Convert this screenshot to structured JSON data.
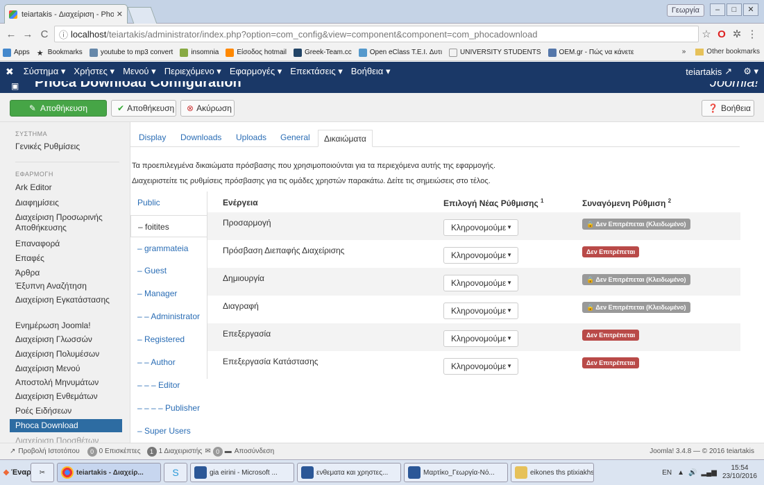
{
  "browser": {
    "tab_title": "teiartakis - Διαχείριση - Pho",
    "user_chip": "Γεωργία",
    "url_host": "localhost",
    "url_path": "/teiartakis/administrator/index.php?option=com_config&view=component&component=com_phocadownload",
    "bookmarks": [
      "Apps",
      "Bookmarks",
      "youtube to mp3 convert",
      "insomnia",
      "Είσοδος hotmail",
      "Greek-Team.cc",
      "Open eClass T.E.I. Δυτι",
      "UNIVERSITY STUDENTS",
      "OEM.gr - Πώς να κάνετε"
    ],
    "other_bookmarks": "Other bookmarks"
  },
  "nav": {
    "menus": [
      "Σύστημα ▾",
      "Χρήστες ▾",
      "Μενού ▾",
      "Περιεχόμενο ▾",
      "Εφαρμογές ▾",
      "Επεκτάσεις ▾",
      "Βοήθεια ▾"
    ],
    "user": "teiartakis"
  },
  "page_title": "Phoca Download Configuration",
  "brand": "Joomla!",
  "toolbar": {
    "save_close": "Αποθήκευση",
    "save": "Αποθήκευση",
    "cancel": "Ακύρωση",
    "help": "Βοήθεια"
  },
  "sidebar": {
    "system_header": "ΣΥΣΤΗΜΑ",
    "system_items": [
      "Γενικές Ρυθμίσεις"
    ],
    "app_header": "ΕΦΑΡΜΟΓΗ",
    "app_items": [
      "Ark Editor",
      "Διαφημίσεις",
      "Διαχείριση Προσωρινής Αποθήκευσης",
      "Επαναφορά",
      "Επαφές",
      "Άρθρα",
      "Έξυπνη Αναζήτηση",
      "Διαχείριση Εγκατάστασης",
      "Ενημέρωση Joomla!",
      "Διαχείριση Γλωσσών",
      "Διαχείριση Πολυμέσων",
      "Διαχείριση Μενού",
      "Αποστολή Μηνυμάτων",
      "Διαχείριση Ενθεμάτων",
      "Ροές Ειδήσεων",
      "Phoca Download",
      "Διαχείριση Προσθέτων"
    ]
  },
  "tabs": [
    "Display",
    "Downloads",
    "Uploads",
    "General",
    "Δικαιώματα"
  ],
  "intro": {
    "line1": "Τα προεπιλεγμένα δικαιώματα πρόσβασης που χρησιμοποιούνται για τα περιεχόμενα αυτής της εφαρμογής.",
    "line2": "Διαχειριστείτε τις ρυθμίσεις πρόσβασης για τις ομάδες χρηστών παρακάτω. Δείτε τις σημειώσεις στο τέλος."
  },
  "groups": [
    "Public",
    "– foitites",
    "– grammateia",
    "– Guest",
    "– Manager",
    "– – Administrator",
    "– Registered",
    "– – Author",
    "– – – Editor",
    "– – – – Publisher",
    "– Super Users"
  ],
  "permissions": {
    "headers": {
      "action": "Ενέργεια",
      "new_setting": "Επιλογή Νέας Ρύθμισης",
      "new_setting_sup": "1",
      "calculated": "Συναγόμενη Ρύθμιση",
      "calculated_sup": "2"
    },
    "rows": [
      {
        "action": "Προσαρμογή",
        "select": "Κληρονομούμε",
        "calc": "Δεν Επιτρέπεται (Κλειδωμένο)",
        "locked": true
      },
      {
        "action": "Πρόσβαση Διεπαφής Διαχείρισης",
        "select": "Κληρονομούμε",
        "calc": "Δεν Επιτρέπεται",
        "locked": false
      },
      {
        "action": "Δημιουργία",
        "select": "Κληρονομούμε",
        "calc": "Δεν Επιτρέπεται (Κλειδωμένο)",
        "locked": true
      },
      {
        "action": "Διαγραφή",
        "select": "Κληρονομούμε",
        "calc": "Δεν Επιτρέπεται (Κλειδωμένο)",
        "locked": true
      },
      {
        "action": "Επεξεργασία",
        "select": "Κληρονομούμε",
        "calc": "Δεν Επιτρέπεται",
        "locked": false
      },
      {
        "action": "Επεξεργασία Κατάστασης",
        "select": "Κληρονομούμε",
        "calc": "Δεν Επιτρέπεται",
        "locked": false
      }
    ]
  },
  "status": {
    "view_site": "Προβολή Ιστοτόπου",
    "visitors_count": "0",
    "visitors_label": "0 Επισκέπτες",
    "admins_count": "1",
    "admins_label": "1 Διαχειριστής",
    "messages_count": "0",
    "logout": "Αποσύνδεση",
    "version": "Joomla! 3.4.8 — © 2016 teiartakis"
  },
  "taskbar": {
    "start": "Έναρξη",
    "items": [
      "teiartakis - Διαχείρ...",
      "gia eirini - Microsoft ...",
      "ενθεματα και χρηστες...",
      "Μαρτίκο_Γεωργία-Νό...",
      "eikones ths ptixiakhs"
    ],
    "lang": "EN",
    "time": "15:54",
    "date": "23/10/2016"
  }
}
